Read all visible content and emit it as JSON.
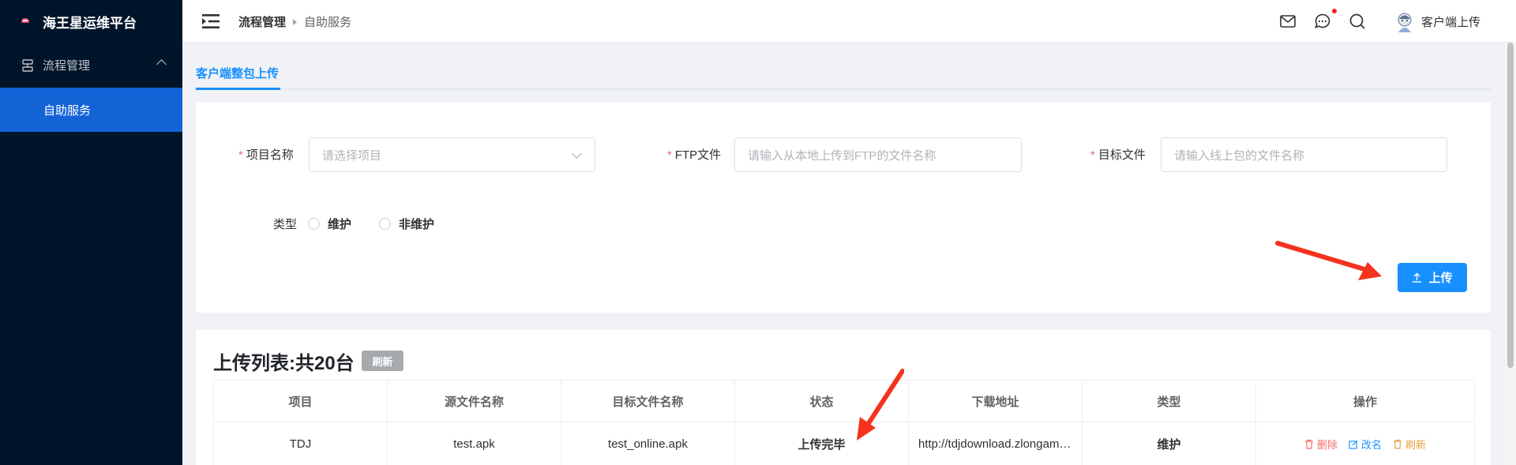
{
  "sidebar": {
    "logo_text": "海王星运维平台",
    "group_label": "流程管理",
    "active_item": "自助服务"
  },
  "header": {
    "breadcrumb": [
      "流程管理",
      "自助服务"
    ],
    "user_name": "客户端上传",
    "icons": [
      "mail-icon",
      "message-icon",
      "search-icon"
    ]
  },
  "tabs": [
    {
      "label": "客户端整包上传",
      "active": true
    }
  ],
  "form": {
    "project": {
      "label": "项目名称",
      "required": true,
      "placeholder": "请选择项目"
    },
    "ftp_file": {
      "label": "FTP文件",
      "required": true,
      "placeholder": "请输入从本地上传到FTP的文件名称"
    },
    "target_file": {
      "label": "目标文件",
      "required": true,
      "placeholder": "请输入线上包的文件名称"
    },
    "type": {
      "label": "类型",
      "options": [
        "维护",
        "非维护"
      ]
    },
    "upload_label": "上传"
  },
  "list": {
    "title": "上传列表:共20台",
    "refresh_label": "刷新",
    "columns": [
      "项目",
      "源文件名称",
      "目标文件名称",
      "状态",
      "下载地址",
      "类型",
      "操作"
    ],
    "rows": [
      {
        "project": "TDJ",
        "source": "test.apk",
        "target": "test_online.apk",
        "status": "上传完毕",
        "url": "http://tdjdownload.zlongame.com/test_online.apk",
        "type": "维护",
        "ops": [
          "删除",
          "改名",
          "刷新"
        ]
      }
    ]
  },
  "colors": {
    "sidebar_bg": "#001529",
    "active_menu": "#1463d6",
    "primary": "#1890ff",
    "danger": "#f56c6c",
    "warning": "#e6a23c",
    "annotation_arrow": "#f5321e"
  }
}
